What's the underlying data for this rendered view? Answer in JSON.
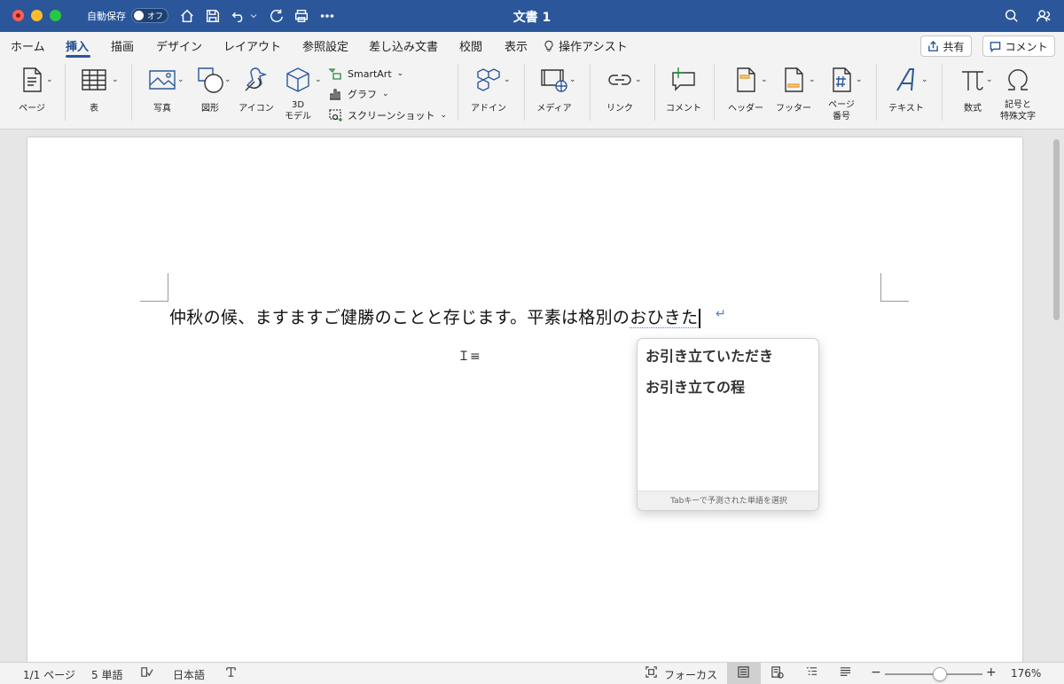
{
  "window": {
    "title": "文書 1",
    "autosave_label": "自動保存",
    "autosave_state": "オフ"
  },
  "tabs": [
    "ホーム",
    "挿入",
    "描画",
    "デザイン",
    "レイアウト",
    "参照設定",
    "差し込み文書",
    "校閲",
    "表示",
    "操作アシスト"
  ],
  "active_tab": "挿入",
  "header_buttons": {
    "share": "共有",
    "comment": "コメント"
  },
  "ribbon": {
    "page": "ページ",
    "table": "表",
    "photo": "写真",
    "shapes": "図形",
    "icons": "アイコン",
    "model3d_1": "3D",
    "model3d_2": "モデル",
    "smartart": "SmartArt",
    "graph": "グラフ",
    "screenshot": "スクリーンショット",
    "addin": "アドイン",
    "media": "メディア",
    "link": "リンク",
    "comment": "コメント",
    "header": "ヘッダー",
    "footer": "フッター",
    "pagenum_1": "ページ",
    "pagenum_2": "番号",
    "text": "テキスト",
    "equation": "数式",
    "symbol_1": "記号と",
    "symbol_2": "特殊文字"
  },
  "document": {
    "text_committed": "仲秋の候、ますますご健勝のことと存じます。平素は格別の",
    "text_ime": "おひきた"
  },
  "suggestions": {
    "items": [
      "お引き立ていただき",
      "お引き立ての程"
    ],
    "footer": "Tabキーで予測された単語を選択"
  },
  "status": {
    "page": "1/1 ページ",
    "words": "5 単語",
    "language": "日本語",
    "focus": "フォーカス",
    "zoom": "176%",
    "zoom_minus": "−",
    "zoom_plus": "+"
  },
  "colors": {
    "title_bar": "#2b579a",
    "accent": "#2b579a"
  }
}
